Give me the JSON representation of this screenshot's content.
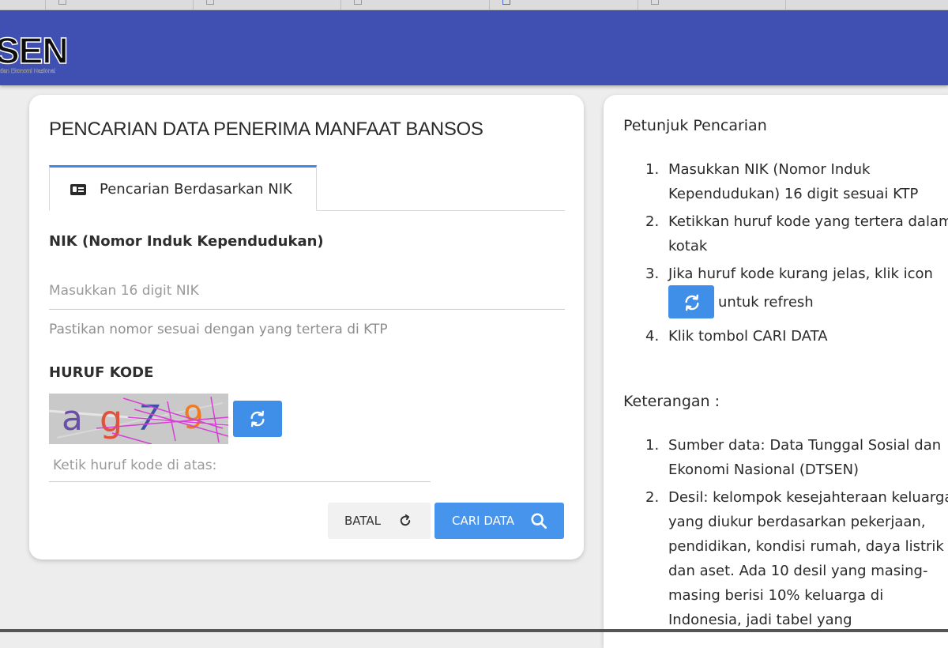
{
  "header": {
    "logo_text": "SEN",
    "logo_subtitle": "dan Ekonomi Nasional",
    "bg_color": "#4050b2"
  },
  "form": {
    "title": "PENCARIAN DATA PENERIMA MANFAAT BANSOS",
    "tab_label": "Pencarian Berdasarkan NIK",
    "tab_icon": "id-card-icon",
    "nik_label": "NIK (Nomor Induk Kependudukan)",
    "nik_placeholder": "Masukkan 16 digit NIK",
    "nik_hint": "Pastikan nomor sesuai dengan yang tertera di KTP",
    "captcha_label": "HURUF KODE",
    "captcha_text": "ag79",
    "captcha_input_placeholder": "Ketik huruf kode di atas:",
    "refresh_icon": "refresh-icon",
    "cancel_label": "BATAL",
    "cancel_icon": "reset-icon",
    "search_label": "CARI DATA",
    "search_icon": "search-icon",
    "accent_color": "#3f8ee8"
  },
  "side": {
    "title": "Petunjuk Pencarian",
    "steps": [
      "Masukkan NIK (Nomor Induk Kependudukan) 16 digit sesuai KTP",
      "Ketikkan huruf kode yang tertera dalam kotak",
      "Jika huruf kode kurang jelas, klik icon",
      "Klik tombol CARI DATA"
    ],
    "step3_suffix": "untuk refresh",
    "notes_title": "Keterangan :",
    "notes": [
      "Sumber data: Data Tunggal Sosial dan Ekonomi Nasional (DTSEN)",
      "Desil: kelompok kesejahteraan keluarga yang diukur berdasarkan pekerjaan, pendidikan, kondisi rumah, daya listrik dan aset. Ada 10 desil yang masing-masing berisi 10% keluarga di Indonesia, jadi tabel yang"
    ]
  }
}
